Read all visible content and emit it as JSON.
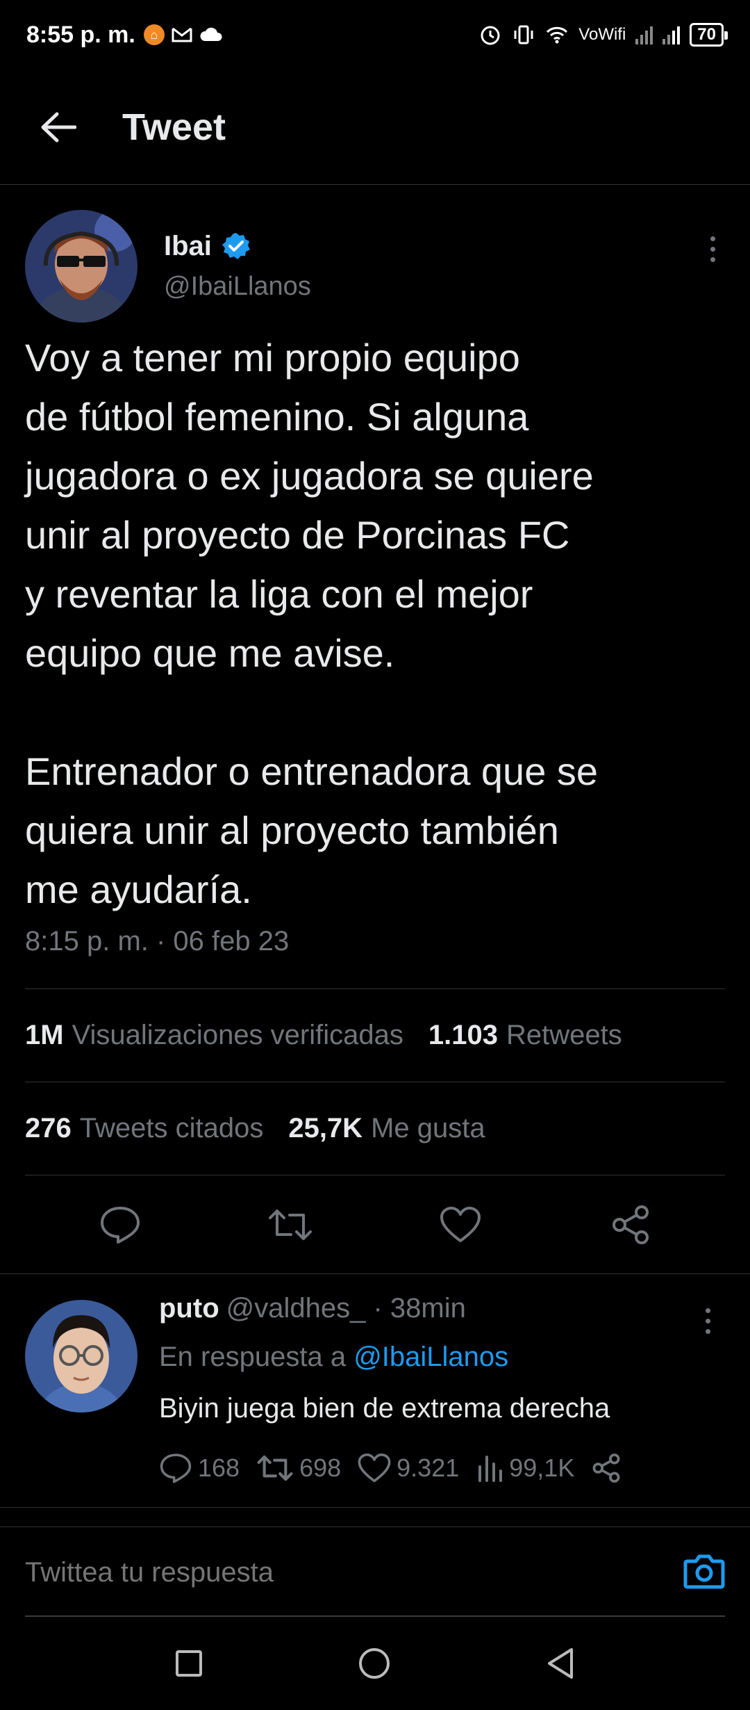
{
  "status_bar": {
    "time": "8:55 p. m.",
    "wifi_label": "VoWifi",
    "battery": "70"
  },
  "header": {
    "title": "Tweet"
  },
  "tweet": {
    "author_name": "Ibai",
    "author_handle": "@IbaiLlanos",
    "paragraph_1": "Voy a tener mi propio equipo\nde fútbol femenino. Si alguna\njugadora o ex jugadora se quiere\nunir al proyecto de Porcinas FC\ny reventar la liga con el mejor\nequipo que me avise.",
    "paragraph_2": "Entrenador o entrenadora que se\nquiera unir al proyecto también\nme ayudaría.",
    "timestamp": "8:15 p. m. · 06 feb 23",
    "stats": {
      "views_num": "1M",
      "views_label": "Visualizaciones verificadas",
      "retweets_num": "1.103",
      "retweets_label": "Retweets",
      "quotes_num": "276",
      "quotes_label": "Tweets citados",
      "likes_num": "25,7K",
      "likes_label": "Me gusta"
    }
  },
  "reply": {
    "name": "puto",
    "handle_time": "@valdhes_ · 38min",
    "reply_to_prefix": "En respuesta a",
    "reply_to_mention": "@IbaiLlanos",
    "text": "Biyin juega bien de extrema derecha",
    "replies": "168",
    "retweets": "698",
    "likes": "9.321",
    "views": "99,1K"
  },
  "composer": {
    "placeholder": "Twittea tu respuesta"
  },
  "colors": {
    "background": "#000000",
    "text": "#e7e9ea",
    "muted": "#71767b",
    "accent": "#1d9bf0",
    "divider": "#2f3336"
  }
}
